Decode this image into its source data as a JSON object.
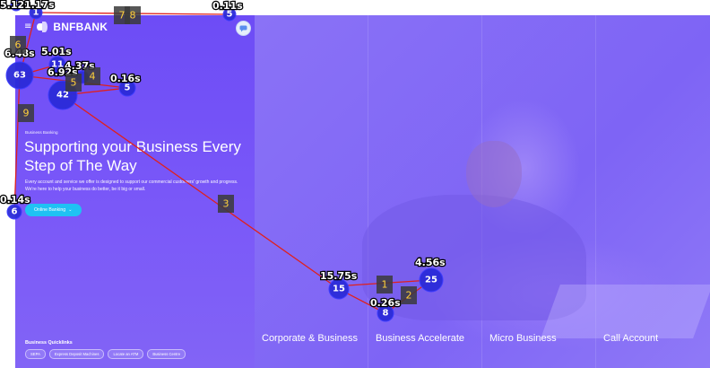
{
  "brand": {
    "menu_icon": "menu-icon",
    "name": "BNFBANK"
  },
  "hero": {
    "eyebrow": "Business Banking",
    "headline": "Supporting your Business Every Step of The Way",
    "lead": "Every account and service we offer is designed to support our commercial customers' growth and progress. We're here to help your business do better, be it big or small.",
    "cta_label": "Online Banking",
    "cta_icon": "chevron-down-icon"
  },
  "quicklinks": {
    "title": "Business Quicklinks",
    "items": [
      "SEPA",
      "Express Deposit Machines",
      "Locate an ATM",
      "Business Centre"
    ]
  },
  "tabs": [
    "Corporate & Business",
    "Business Accelerate",
    "Micro Business",
    "Call Account"
  ],
  "chat": {
    "icon": "chat-icon"
  },
  "gaze": {
    "colors": {
      "fixation": "#2b2bd9",
      "path": "#e0201c",
      "step_label": "#ffd23a"
    },
    "fixations": [
      {
        "n": "1",
        "time": "5.12s"
      },
      {
        "n": "1",
        "time": "1.17s"
      },
      {
        "n": "5",
        "time": "0.11s"
      },
      {
        "n": "63",
        "time": "6.48s"
      },
      {
        "n": "11",
        "time": "5.01s"
      },
      {
        "n": "",
        "time": "4.37s"
      },
      {
        "n": "42",
        "time": "6.92s"
      },
      {
        "n": "5",
        "time": "0.16s"
      },
      {
        "n": "6",
        "time": "0.14s"
      },
      {
        "n": "15",
        "time": "15.75s"
      },
      {
        "n": "25",
        "time": "4.56s"
      },
      {
        "n": "8",
        "time": "0.26s"
      }
    ],
    "steps": [
      "1",
      "2",
      "3",
      "4",
      "5",
      "6",
      "7",
      "8",
      "9"
    ]
  }
}
